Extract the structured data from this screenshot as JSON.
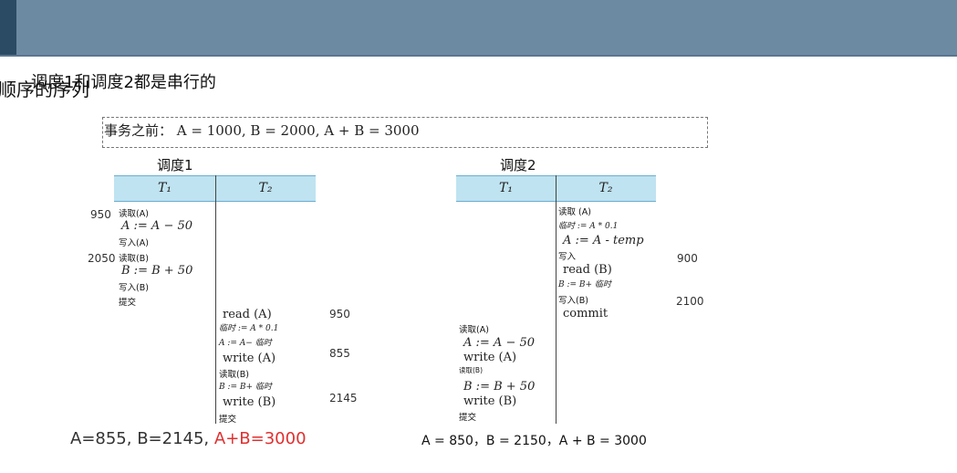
{
  "slide": {
    "title_overlay_a": "顺序的序列",
    "title_overlay_b": "调度1和调度2都是串行的",
    "before": "事务之前：  A = 1000, B = 2000, A + B = 3000"
  },
  "schedule1": {
    "label": "调度1",
    "headers": [
      "T₁",
      "T₂"
    ],
    "t1_ops": [
      {
        "text": "读取(A)",
        "kind": "op"
      },
      {
        "text": "A := A − 50",
        "kind": "math"
      },
      {
        "text": "写入(A)",
        "kind": "op"
      },
      {
        "text": "读取(B)",
        "kind": "op"
      },
      {
        "text": "B := B + 50",
        "kind": "math"
      },
      {
        "text": "写入(B)",
        "kind": "op"
      },
      {
        "text": "提交",
        "kind": "op"
      }
    ],
    "t1_values": [
      "950",
      "2050"
    ],
    "t2_ops": [
      {
        "text": "read (A)",
        "kind": "serif"
      },
      {
        "text": "临时 := A * 0.1",
        "kind": "small"
      },
      {
        "text": "A := A− 临时",
        "kind": "small"
      },
      {
        "text": "write (A)",
        "kind": "serif"
      },
      {
        "text": "读取(B)",
        "kind": "op"
      },
      {
        "text": "B := B+ 临时",
        "kind": "small"
      },
      {
        "text": "write (B)",
        "kind": "serif"
      },
      {
        "text": "提交",
        "kind": "op"
      }
    ],
    "t2_values": [
      "950",
      "855",
      "2145"
    ],
    "result_prefix": "A=855,  B=2145,",
    "result_sum": "A+B=3000"
  },
  "schedule2": {
    "label": "调度2",
    "headers": [
      "T₁",
      "T₂"
    ],
    "t2_ops": [
      {
        "text": "读取 (A)",
        "kind": "op"
      },
      {
        "text": "临时 := A * 0.1",
        "kind": "small"
      },
      {
        "text": "A := A - temp",
        "kind": "math"
      },
      {
        "text": "写入",
        "kind": "op"
      },
      {
        "text": "read (B)",
        "kind": "serif"
      },
      {
        "text": "B := B+ 临时",
        "kind": "small"
      },
      {
        "text": "写入(B)",
        "kind": "op"
      },
      {
        "text": "commit",
        "kind": "serif"
      }
    ],
    "t2_values": [
      "900",
      "2100"
    ],
    "t1_ops": [
      {
        "text": "读取(A)",
        "kind": "op"
      },
      {
        "text": "A := A − 50",
        "kind": "math"
      },
      {
        "text": "write (A)",
        "kind": "serif"
      },
      {
        "text": "读取(B)",
        "kind": "op"
      },
      {
        "text": "B := B + 50",
        "kind": "math"
      },
      {
        "text": "write (B)",
        "kind": "serif"
      },
      {
        "text": "提交",
        "kind": "op"
      }
    ],
    "result": "A = 850，B = 2150，A + B = 3000"
  }
}
